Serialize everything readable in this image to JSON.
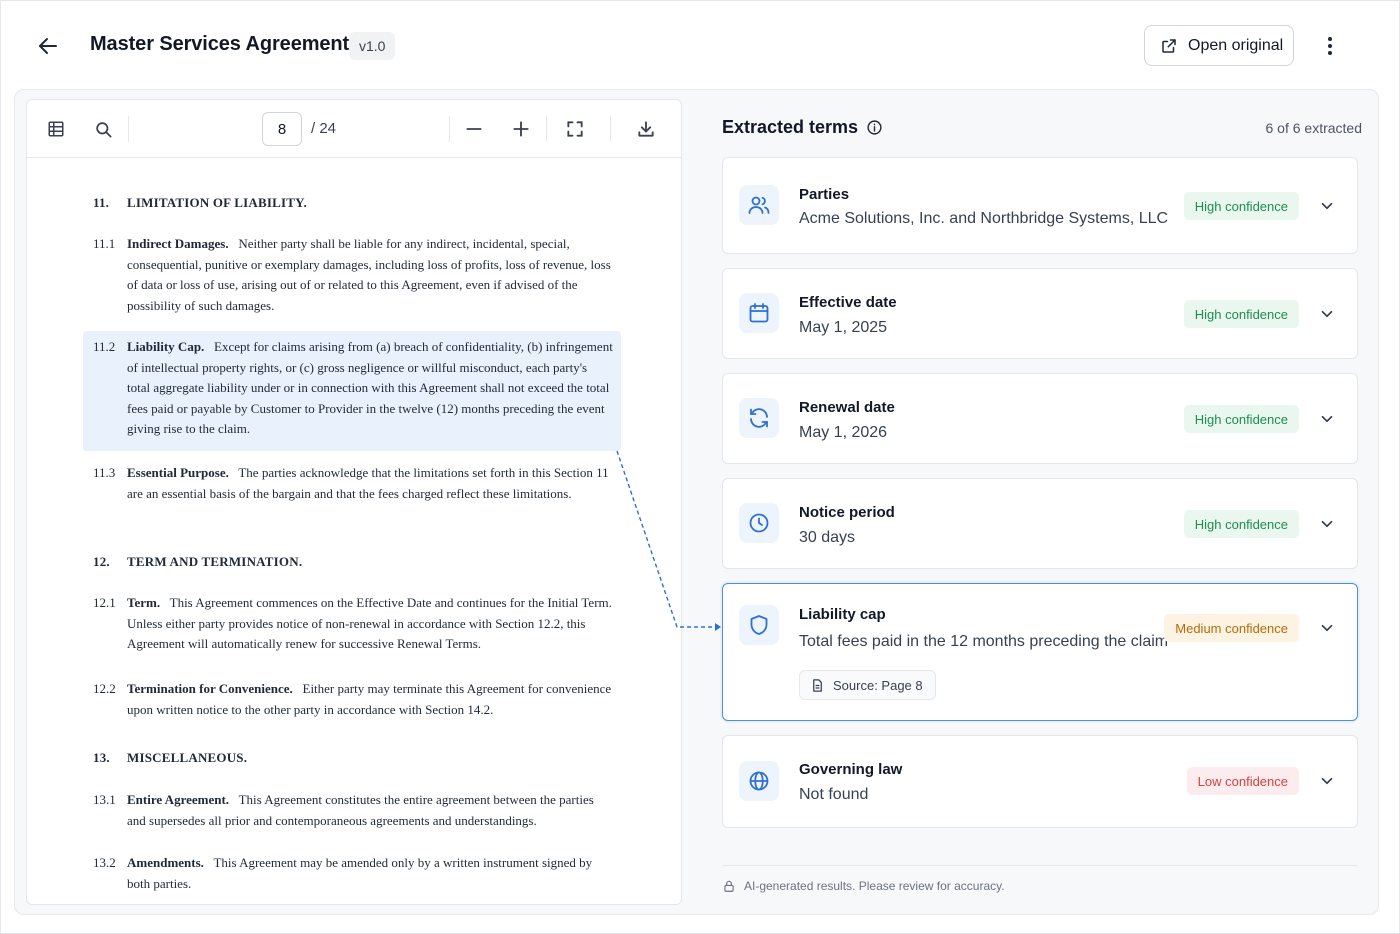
{
  "header": {
    "title": "Master Services Agreement",
    "version": "v1.0",
    "open_original_label": "Open original"
  },
  "viewer": {
    "current_page": "8",
    "total_pages": "/ 24",
    "sections": [
      {
        "number": "11.",
        "title": "LIMITATION OF LIABILITY."
      },
      {
        "number": "12.",
        "title": "TERM AND TERMINATION."
      },
      {
        "number": "13.",
        "title": "MISCELLANEOUS."
      }
    ],
    "clauses": [
      {
        "number": "11.1",
        "heading": "Indirect Damages.",
        "text": "Neither party shall be liable for any indirect, incidental, special, consequential, punitive or exemplary damages, including loss of profits, loss of revenue, loss of data or loss of use, arising out of or related to this Agreement, even if advised of the possibility of such damages."
      },
      {
        "number": "11.2",
        "heading": "Liability Cap.",
        "text": "Except for claims arising from (a) breach of confidentiality, (b) infringement of intellectual property rights, or (c) gross negligence or willful misconduct, each party's total aggregate liability under or in connection with this Agreement shall not exceed the total fees paid or payable by Customer to Provider in the twelve (12) months preceding the event giving rise to the claim."
      },
      {
        "number": "11.3",
        "heading": "Essential Purpose.",
        "text": "The parties acknowledge that the limitations set forth in this Section 11 are an essential basis of the bargain and that the fees charged reflect these limitations."
      },
      {
        "number": "12.1",
        "heading": "Term.",
        "text": "This Agreement commences on the Effective Date and continues for the Initial Term. Unless either party provides notice of non-renewal in accordance with Section 12.2, this Agreement will automatically renew for successive Renewal Terms."
      },
      {
        "number": "12.2",
        "heading": "Termination for Convenience.",
        "text": "Either party may terminate this Agreement for convenience upon written notice to the other party in accordance with Section 14.2."
      },
      {
        "number": "13.1",
        "heading": "Entire Agreement.",
        "text": "This Agreement constitutes the entire agreement between the parties and supersedes all prior and contemporaneous agreements and understandings."
      },
      {
        "number": "13.2",
        "heading": "Amendments.",
        "text": "This Agreement may be amended only by a written instrument signed by both parties."
      }
    ]
  },
  "panel": {
    "title": "Extracted terms",
    "count": "6 of 6 extracted",
    "terms": [
      {
        "label": "Parties",
        "value": "Acme Solutions, Inc. and Northbridge Systems, LLC",
        "confidence": "High confidence",
        "icon": "users-icon"
      },
      {
        "label": "Effective date",
        "value": "May 1, 2025",
        "confidence": "High confidence",
        "icon": "calendar-icon"
      },
      {
        "label": "Renewal date",
        "value": "May 1, 2026",
        "confidence": "High confidence",
        "icon": "refresh-icon"
      },
      {
        "label": "Notice period",
        "value": "30 days",
        "confidence": "High confidence",
        "icon": "clock-icon"
      },
      {
        "label": "Liability cap",
        "value": "Total fees paid in the 12 months preceding the claim",
        "confidence": "Medium confidence",
        "icon": "shield-icon",
        "source": "Source: Page 8"
      },
      {
        "label": "Governing law",
        "value": "Not found",
        "confidence": "Low confidence",
        "icon": "globe-icon"
      }
    ],
    "disclaimer": "AI-generated results. Please review for accuracy."
  },
  "colors": {
    "accent": "#2f6fd1",
    "highlight": "#e8f1fc",
    "high": "#1e8e4e",
    "medium": "#b86b0b",
    "low": "#d14343"
  }
}
